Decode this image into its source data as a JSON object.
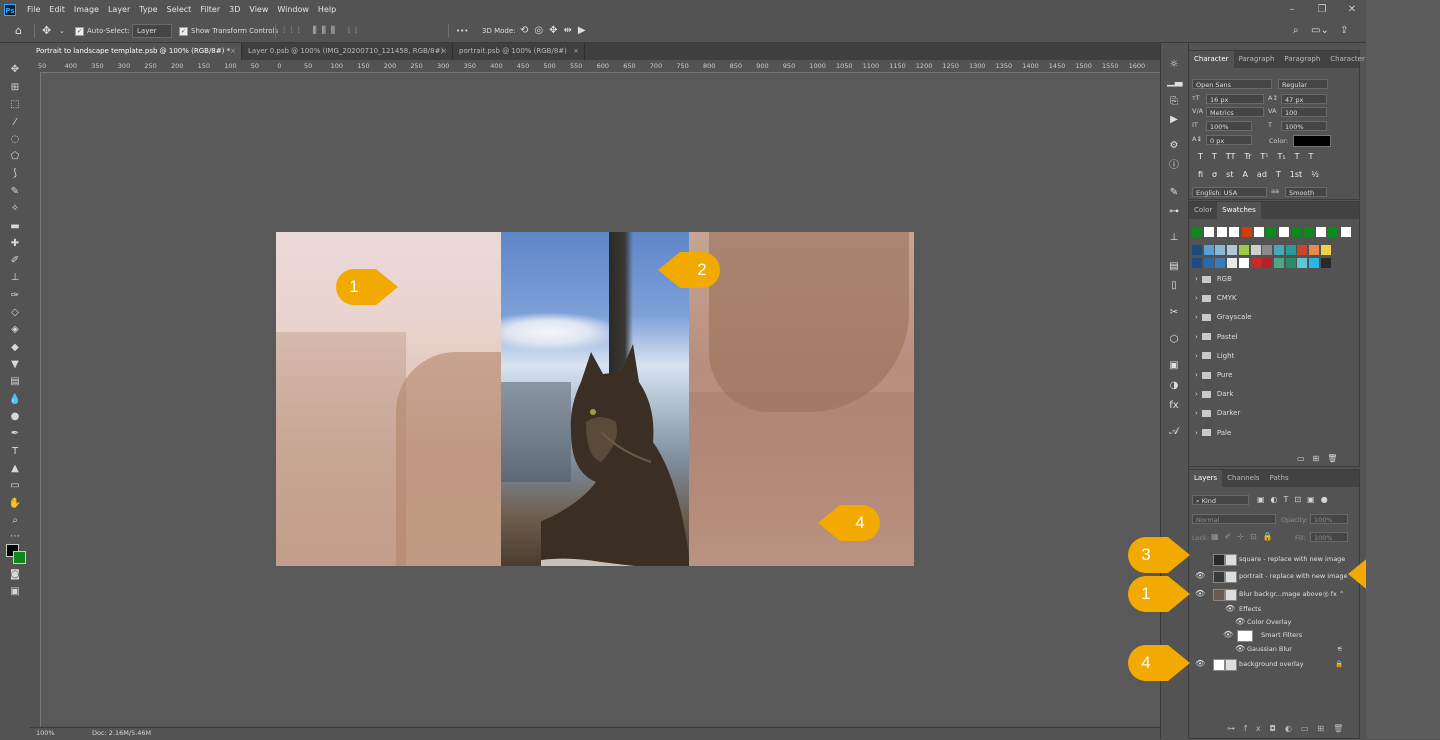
{
  "menubar": {
    "items": [
      "File",
      "Edit",
      "Image",
      "Layer",
      "Type",
      "Select",
      "Filter",
      "3D",
      "View",
      "Window",
      "Help"
    ]
  },
  "options": {
    "auto_select_label": "Auto-Select:",
    "auto_select_value": "Layer",
    "transform_label": "Show Transform Controls",
    "mode_3d_label": "3D Mode:",
    "more": "•••"
  },
  "tabs": [
    {
      "label": "Portrait to landscape template.psb @ 100% (RGB/8#) *",
      "active": true
    },
    {
      "label": "Layer 0.psb @ 100% (IMG_20200710_121458, RGB/8#)",
      "active": false
    },
    {
      "label": "portrait.psb @ 100% (RGB/8#)",
      "active": false
    }
  ],
  "ruler": {
    "h_ticks": [
      "50",
      "400",
      "350",
      "300",
      "250",
      "200",
      "150",
      "100",
      "50",
      "0",
      "50",
      "100",
      "150",
      "200",
      "250",
      "300",
      "350",
      "400",
      "450",
      "500",
      "550",
      "600",
      "650",
      "700",
      "750",
      "800",
      "850",
      "900",
      "950",
      "1000",
      "1050",
      "1100",
      "1150",
      "1200",
      "1250",
      "1300",
      "1350",
      "1400",
      "1450",
      "1500",
      "1550",
      "1600"
    ]
  },
  "status": {
    "zoom": "100%",
    "doc": "Doc: 2.16M/5.46M"
  },
  "callouts": {
    "c1": "1",
    "c2": "2",
    "c3": "3",
    "c4": "4"
  },
  "character": {
    "tabs": [
      "Character",
      "Paragraph",
      "Paragraph",
      "Character"
    ],
    "font_family": "Open Sans",
    "font_style": "Regular",
    "font_size": "16 px",
    "leading": "47 px",
    "kerning": "Metrics",
    "tracking": "100",
    "vscale": "100%",
    "hscale": "100%",
    "baseline": "0 px",
    "color_label": "Color:",
    "language": "English: USA",
    "antialias": "Smooth",
    "style_buttons": [
      "T",
      "T",
      "TT",
      "Tr",
      "T¹",
      "T₁",
      "T",
      "T"
    ],
    "ot_buttons": [
      "fi",
      "σ",
      "st",
      "A",
      "ad",
      "T",
      "1st",
      "½"
    ]
  },
  "swatches": {
    "tabs": [
      "Color",
      "Swatches"
    ],
    "recent": [
      "#0a8a1a",
      "#ffffff",
      "#ffffff",
      "#ffffff",
      "#d83a0a",
      "#ffffff",
      "#0a8a1a",
      "#ffffff",
      "#0a8a1a",
      "#0a8a1a",
      "#ffffff",
      "#0a8a1a",
      "#ffffff"
    ],
    "row1": [
      "#1e4a7a",
      "#5aa0d8",
      "#8ab8d8",
      "#b0c7d8",
      "#9ec84a",
      "#cfcfcf",
      "#8a8a8a",
      "#49a8b8",
      "#2a9a9a",
      "#c8462a",
      "#e88a4a",
      "#f0d04a"
    ],
    "row2": [
      "#1e4a8a",
      "#2a6aa8",
      "#3a7ab8",
      "#e8e8e8",
      "#ffffff",
      "#c82a2a",
      "#b8202a",
      "#4aa888",
      "#2a8a6a",
      "#5ac8d8",
      "#28b8e8",
      "#2a2a2a"
    ],
    "folders": [
      "RGB",
      "CMYK",
      "Grayscale",
      "Pastel",
      "Light",
      "Pure",
      "Dark",
      "Darker",
      "Pale"
    ]
  },
  "layers_panel": {
    "tabs": [
      "Layers",
      "Channels",
      "Paths"
    ],
    "filter_kind": "Kind",
    "blend_mode": "Normal",
    "opacity_label": "Opacity:",
    "opacity_value": "100%",
    "lock_label": "Lock:",
    "fill_label": "Fill:",
    "fill_value": "100%",
    "layers": [
      {
        "name": "square - replace with new image",
        "visible": false
      },
      {
        "name": "portrait - replace with new image",
        "visible": true
      },
      {
        "name": "Blur backgr...mage above",
        "visible": true
      },
      {
        "name": "Effects",
        "visible": true
      },
      {
        "name": "Color Overlay",
        "visible": true
      },
      {
        "name": "Smart Filters",
        "visible": true
      },
      {
        "name": "Gaussian Blur",
        "visible": true
      },
      {
        "name": "background overlay",
        "visible": true
      }
    ]
  }
}
